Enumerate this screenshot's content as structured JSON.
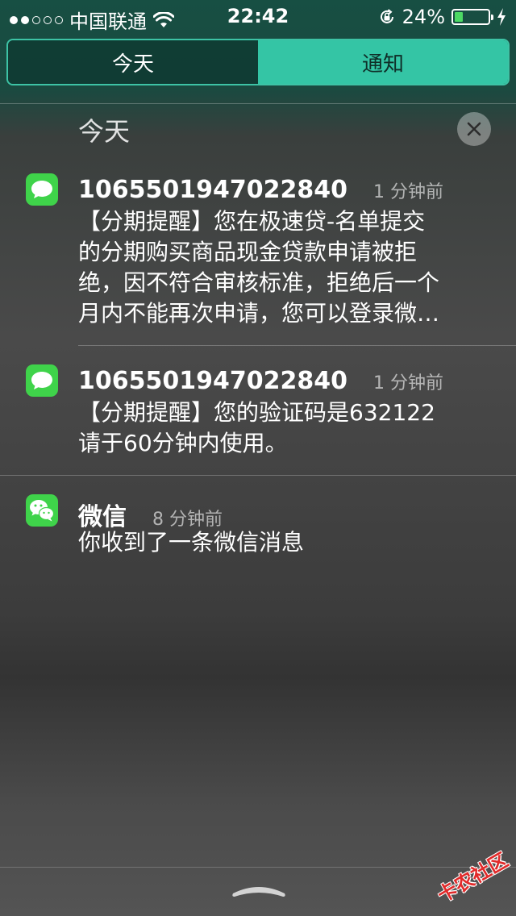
{
  "status_bar": {
    "carrier": "中国联通",
    "time": "22:42",
    "battery_percent": "24%",
    "battery_level": 0.24,
    "signal_bars_total": 5,
    "signal_bars_on": 2
  },
  "tabs": [
    {
      "label": "今天",
      "selected": false
    },
    {
      "label": "通知",
      "selected": true
    }
  ],
  "section": {
    "title": "今天"
  },
  "notifications": [
    {
      "app": "messages",
      "sender": "1065501947022840",
      "time": "1 分钟前",
      "body": [
        "【分期提醒】您在极速贷-名单提交",
        "的分期购买商品现金贷款申请被拒",
        "绝，因不符合审核标准，拒绝后一个",
        "月内不能再次申请，您可以登录微…"
      ]
    },
    {
      "app": "messages",
      "sender": "1065501947022840",
      "time": "1 分钟前",
      "body": [
        "【分期提醒】您的验证码是632122",
        "请于60分钟内使用。"
      ]
    },
    {
      "app": "wechat",
      "sender": "微信",
      "time": "8 分钟前",
      "body": [
        "你收到了一条微信消息"
      ]
    }
  ],
  "watermark": "卡农社区",
  "colors": {
    "accent": "#34c5a5",
    "messages_green": "#3fd34a",
    "battery_green": "#4cd964",
    "watermark_red": "#e12b2b"
  }
}
